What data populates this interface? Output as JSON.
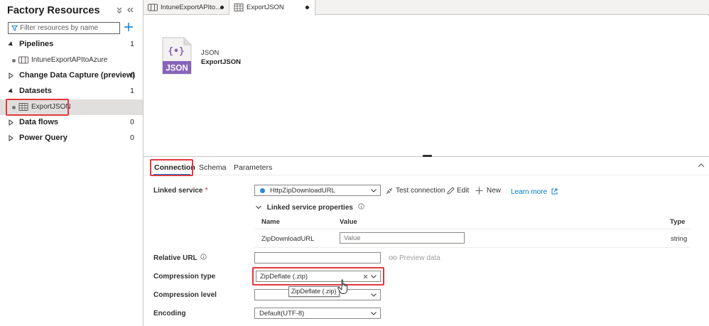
{
  "panel": {
    "title": "Factory Resources",
    "filter_placeholder": "Filter resources by name",
    "sections": [
      {
        "label": "Pipelines",
        "count": "1",
        "expanded": true
      },
      {
        "label": "Change Data Capture (preview)",
        "count": "0",
        "expanded": false
      },
      {
        "label": "Datasets",
        "count": "1",
        "expanded": true
      },
      {
        "label": "Data flows",
        "count": "0",
        "expanded": false
      },
      {
        "label": "Power Query",
        "count": "0",
        "expanded": false
      }
    ],
    "pipeline_item": "IntuneExportAPItoAzure",
    "dataset_item": "ExportJSON"
  },
  "tabs": [
    {
      "label": "IntuneExportAPIto...",
      "icon": "pipeline-icon",
      "modified": true
    },
    {
      "label": "ExportJSON",
      "icon": "table-icon",
      "modified": true
    }
  ],
  "dataset": {
    "icon_label": "JSON",
    "type": "JSON",
    "name": "ExportJSON"
  },
  "subtabs": {
    "connection": "Connection",
    "schema": "Schema",
    "parameters": "Parameters"
  },
  "form": {
    "linked_service": {
      "label": "Linked service",
      "required_mark": "*",
      "value": "HttpZipDownloadURL",
      "test_connection": "Test connection",
      "edit": "Edit",
      "new": "New",
      "learn_more": "Learn more"
    },
    "linked_service_properties": {
      "title": "Linked service properties",
      "headers": {
        "name": "Name",
        "value": "Value",
        "type": "Type"
      },
      "row": {
        "name": "ZipDownloadURL",
        "value_placeholder": "Value",
        "type": "string"
      }
    },
    "relative_url": {
      "label": "Relative URL",
      "value": "",
      "preview": "Preview data"
    },
    "compression_type": {
      "label": "Compression type",
      "value": "ZipDeflate (.zip)",
      "tooltip": "ZipDeflate (.zip)"
    },
    "compression_level": {
      "label": "Compression level",
      "value": ""
    },
    "encoding": {
      "label": "Encoding",
      "value": "Default(UTF-8)"
    }
  },
  "colors": {
    "accent": "#0078d4",
    "highlight": "#e0393e",
    "json_icon": "#8764b8",
    "linked_service_dot": "#2b88d8"
  }
}
